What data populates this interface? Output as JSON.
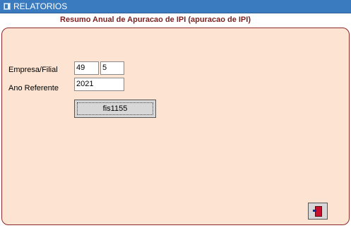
{
  "window": {
    "title": "RELATORIOS",
    "icon": "window-icon"
  },
  "form": {
    "heading": "Resumo Anual de Apuracao de IPI (apuracao de IPI)",
    "empresa_label": "Empresa/Filial",
    "empresa_value": "49",
    "filial_value": "5",
    "ano_label": "Ano Referente",
    "ano_value": "2021",
    "run_button_label": "fis1155"
  },
  "exit_button": {
    "icon": "exit-door-icon"
  },
  "colors": {
    "titlebar": "#3a7bbf",
    "panel": "#fce3d2",
    "heading": "#7a1f1f"
  }
}
